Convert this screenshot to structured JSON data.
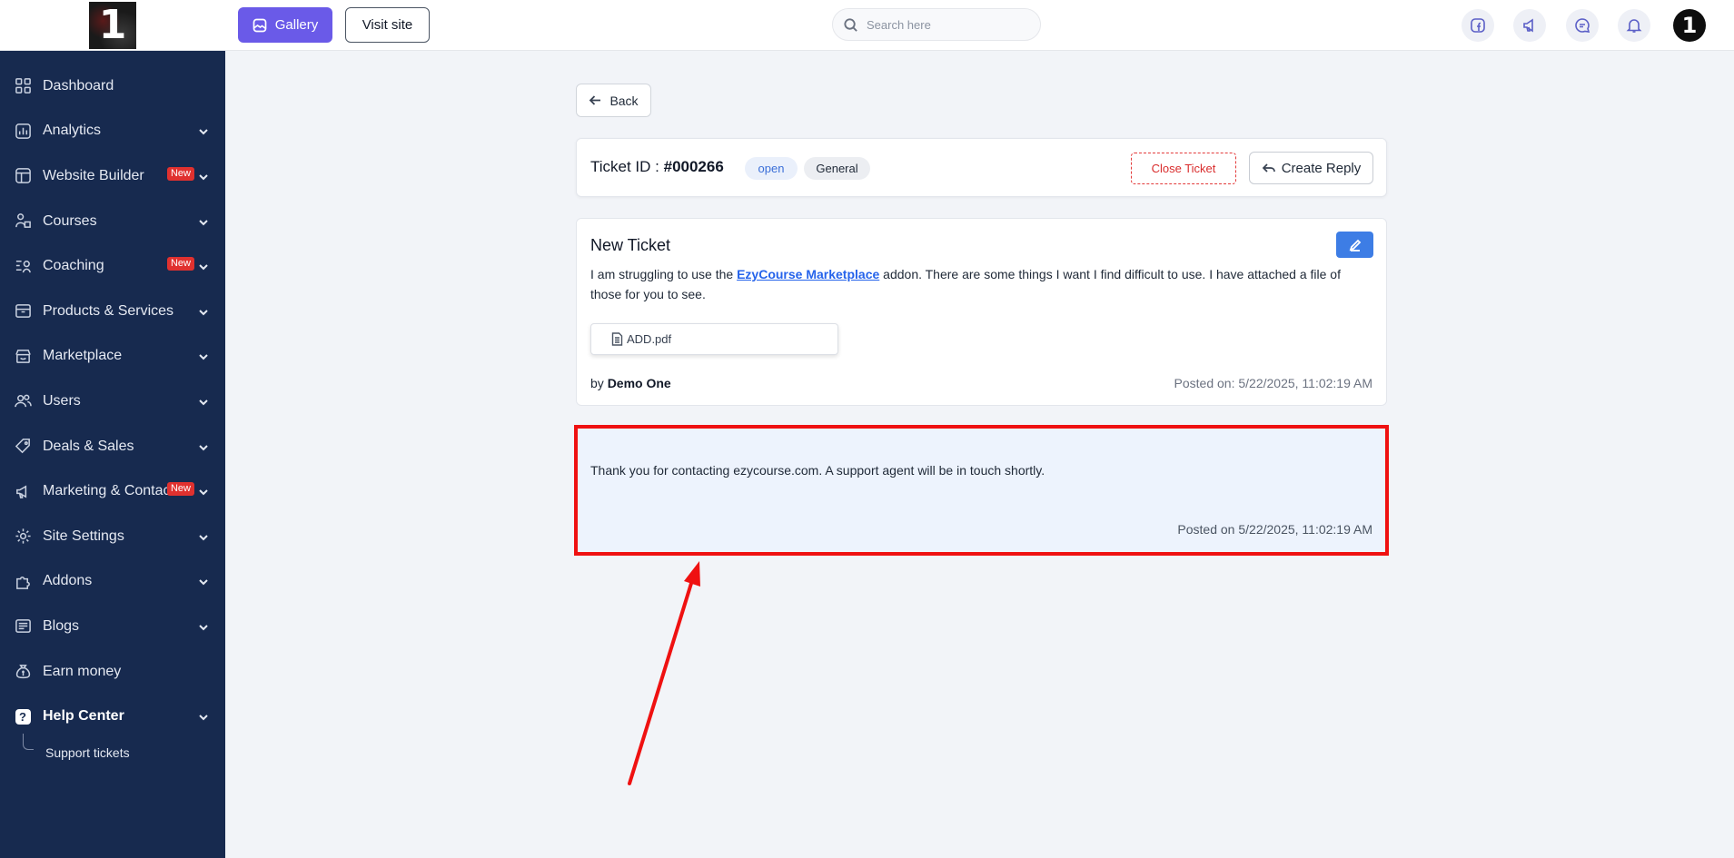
{
  "sidebar": {
    "logo_text": "1",
    "items": [
      {
        "label": "Dashboard",
        "icon": "dashboard-icon",
        "has_chevron": false
      },
      {
        "label": "Analytics",
        "icon": "analytics-icon",
        "has_chevron": true
      },
      {
        "label": "Website Builder",
        "icon": "website-builder-icon",
        "has_chevron": true,
        "badge": "New"
      },
      {
        "label": "Courses",
        "icon": "courses-icon",
        "has_chevron": true
      },
      {
        "label": "Coaching",
        "icon": "coaching-icon",
        "has_chevron": true,
        "badge": "New"
      },
      {
        "label": "Products & Services",
        "icon": "products-icon",
        "has_chevron": true
      },
      {
        "label": "Marketplace",
        "icon": "marketplace-icon",
        "has_chevron": true
      },
      {
        "label": "Users",
        "icon": "users-icon",
        "has_chevron": true
      },
      {
        "label": "Deals & Sales",
        "icon": "deals-tag-icon",
        "has_chevron": true
      },
      {
        "label": "Marketing & Contacts",
        "icon": "megaphone-icon",
        "has_chevron": true,
        "badge": "New"
      },
      {
        "label": "Site Settings",
        "icon": "gear-icon",
        "has_chevron": true
      },
      {
        "label": "Addons",
        "icon": "addons-icon",
        "has_chevron": true
      },
      {
        "label": "Blogs",
        "icon": "blogs-icon",
        "has_chevron": true
      },
      {
        "label": "Earn money",
        "icon": "money-bag-icon",
        "has_chevron": false
      },
      {
        "label": "Help Center",
        "icon": "help-icon",
        "has_chevron": true,
        "active": true
      }
    ],
    "subitems": [
      {
        "label": "Support tickets"
      }
    ]
  },
  "topbar": {
    "gallery_label": "Gallery",
    "visit_site_label": "Visit site",
    "search_placeholder": "Search here",
    "avatar_text": "1",
    "icons": [
      "facebook-icon",
      "megaphone-icon",
      "chat-icon",
      "bell-icon"
    ]
  },
  "main": {
    "back_label": "Back",
    "ticket": {
      "id_label": "Ticket ID : ",
      "id_value": "#000266",
      "status": "open",
      "category": "General",
      "close_label": "Close Ticket",
      "reply_label": "Create Reply"
    },
    "body": {
      "title": "New Ticket",
      "text_before": "I am struggling to use the ",
      "link_text": "EzyCourse Marketplace",
      "text_after": " addon. There are some things I want I find difficult to use. I have attached a file of those for you to see.",
      "attachment_name": "ADD.pdf",
      "by_label": "by ",
      "author": "Demo One",
      "posted": "Posted on: 5/22/2025, 11:02:19 AM"
    },
    "reply": {
      "text": "Thank you for contacting ezycourse.com. A support agent will be in touch shortly.",
      "posted": "Posted on 5/22/2025, 11:02:19 AM"
    }
  },
  "colors": {
    "sidebar_bg": "#172a4f",
    "accent": "#6a5ae8",
    "highlight_border": "#ef1111",
    "reply_bg": "#edf3fd",
    "badge_new": "#e0312f"
  }
}
